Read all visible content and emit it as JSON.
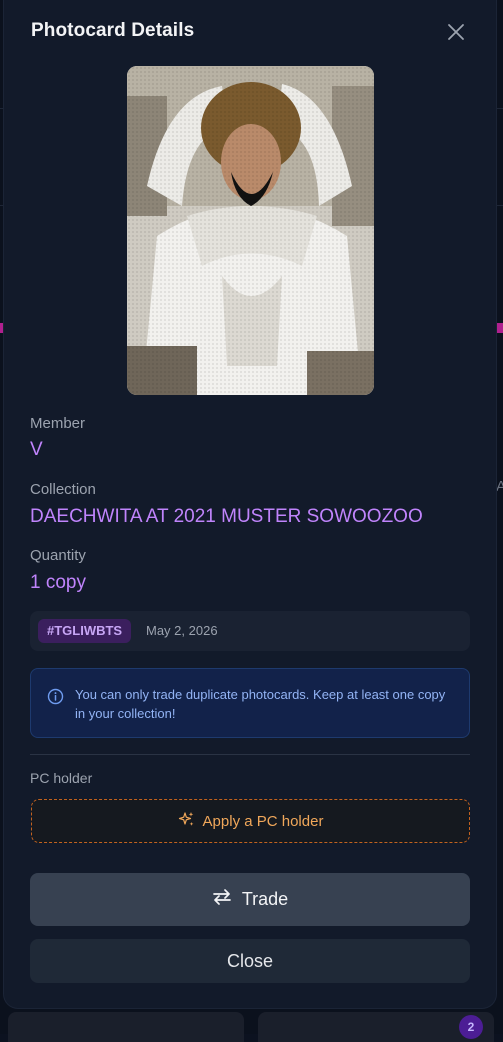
{
  "modal": {
    "title": "Photocard Details",
    "close_icon": "close-icon"
  },
  "photocard": {
    "image_description": "photocard-image",
    "member_label": "Member",
    "member": "V",
    "collection_label": "Collection",
    "collection": "DAECHWITA AT 2021 MUSTER SOWOOZOO",
    "quantity_label": "Quantity",
    "quantity": "1 copy",
    "tag": "#TGLIWBTS",
    "date": "May 2, 2026"
  },
  "notice": {
    "icon": "info-icon",
    "text": "You can only trade duplicate photocards. Keep at least one copy in your collection!"
  },
  "pc_holder": {
    "label": "PC holder",
    "button_icon": "sparkles-icon",
    "button_label": "Apply a PC holder"
  },
  "actions": {
    "trade_icon": "swap-arrows-icon",
    "trade_label": "Trade",
    "close_label": "Close"
  },
  "background": {
    "badge_count": "2",
    "edge_char": "A"
  },
  "colors": {
    "accent_purple": "#c084fc",
    "info_blue": "#93b4f5",
    "holder_orange": "#f0a75a",
    "modal_bg": "#121a2a"
  }
}
